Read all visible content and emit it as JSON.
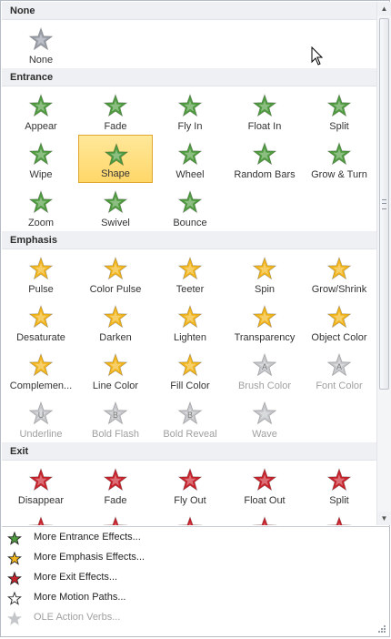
{
  "sections": [
    {
      "title": "None",
      "items": [
        {
          "label": "None",
          "icon": "none-star-icon",
          "disabled": false
        }
      ]
    },
    {
      "title": "Entrance",
      "items": [
        {
          "label": "Appear",
          "icon": "appear-star-icon"
        },
        {
          "label": "Fade",
          "icon": "fade-star-icon"
        },
        {
          "label": "Fly In",
          "icon": "fly-in-star-icon"
        },
        {
          "label": "Float In",
          "icon": "float-in-star-icon"
        },
        {
          "label": "Split",
          "icon": "split-star-icon"
        },
        {
          "label": "Wipe",
          "icon": "wipe-star-icon"
        },
        {
          "label": "Shape",
          "icon": "shape-star-icon",
          "selected": true
        },
        {
          "label": "Wheel",
          "icon": "wheel-star-icon"
        },
        {
          "label": "Random Bars",
          "icon": "random-bars-star-icon"
        },
        {
          "label": "Grow & Turn",
          "icon": "grow-turn-star-icon"
        },
        {
          "label": "Zoom",
          "icon": "zoom-star-icon"
        },
        {
          "label": "Swivel",
          "icon": "swivel-star-icon"
        },
        {
          "label": "Bounce",
          "icon": "bounce-star-icon"
        }
      ]
    },
    {
      "title": "Emphasis",
      "items": [
        {
          "label": "Pulse",
          "icon": "pulse-star-icon"
        },
        {
          "label": "Color Pulse",
          "icon": "color-pulse-star-icon"
        },
        {
          "label": "Teeter",
          "icon": "teeter-star-icon"
        },
        {
          "label": "Spin",
          "icon": "spin-star-icon"
        },
        {
          "label": "Grow/Shrink",
          "icon": "grow-shrink-star-icon"
        },
        {
          "label": "Desaturate",
          "icon": "desaturate-star-icon"
        },
        {
          "label": "Darken",
          "icon": "darken-star-icon"
        },
        {
          "label": "Lighten",
          "icon": "lighten-star-icon"
        },
        {
          "label": "Transparency",
          "icon": "transparency-star-icon"
        },
        {
          "label": "Object Color",
          "icon": "object-color-star-icon"
        },
        {
          "label": "Complemen...",
          "icon": "complementary-color-star-icon"
        },
        {
          "label": "Line Color",
          "icon": "line-color-star-icon"
        },
        {
          "label": "Fill Color",
          "icon": "fill-color-star-icon"
        },
        {
          "label": "Brush Color",
          "icon": "brush-color-icon",
          "disabled": true
        },
        {
          "label": "Font Color",
          "icon": "font-color-icon",
          "disabled": true
        },
        {
          "label": "Underline",
          "icon": "underline-icon",
          "disabled": true
        },
        {
          "label": "Bold Flash",
          "icon": "bold-flash-icon",
          "disabled": true
        },
        {
          "label": "Bold Reveal",
          "icon": "bold-reveal-icon",
          "disabled": true
        },
        {
          "label": "Wave",
          "icon": "wave-icon",
          "disabled": true
        }
      ]
    },
    {
      "title": "Exit",
      "items": [
        {
          "label": "Disappear",
          "icon": "disappear-star-icon"
        },
        {
          "label": "Fade",
          "icon": "fade-exit-star-icon"
        },
        {
          "label": "Fly Out",
          "icon": "fly-out-star-icon"
        },
        {
          "label": "Float Out",
          "icon": "float-out-star-icon"
        },
        {
          "label": "Split",
          "icon": "split-exit-star-icon"
        },
        {
          "label": "",
          "icon": "wipe-exit-star-icon"
        },
        {
          "label": "",
          "icon": "shape-exit-star-icon"
        },
        {
          "label": "",
          "icon": "wheel-exit-star-icon"
        },
        {
          "label": "",
          "icon": "random-bars-exit-star-icon"
        },
        {
          "label": "",
          "icon": "shrink-turn-exit-star-icon"
        }
      ]
    }
  ],
  "menu": [
    {
      "label": "More Entrance Effects...",
      "icon": "entrance-effects-icon",
      "disabled": false
    },
    {
      "label": "More Emphasis Effects...",
      "icon": "emphasis-effects-icon",
      "disabled": false
    },
    {
      "label": "More Exit Effects...",
      "icon": "exit-effects-icon",
      "disabled": false
    },
    {
      "label": "More Motion Paths...",
      "icon": "motion-paths-icon",
      "disabled": false
    },
    {
      "label": "OLE Action Verbs...",
      "icon": "ole-action-verbs-icon",
      "disabled": true
    }
  ],
  "colors": {
    "entrance": "#4f9b3f",
    "emphasis": "#f2b51d",
    "exit": "#c8232c",
    "none": "#9a9fa8",
    "disabled": "#c4c6ca",
    "selected_bg": "#ffd769"
  },
  "scrollbar": {
    "up_arrow": "▲",
    "down_arrow": "▼"
  }
}
